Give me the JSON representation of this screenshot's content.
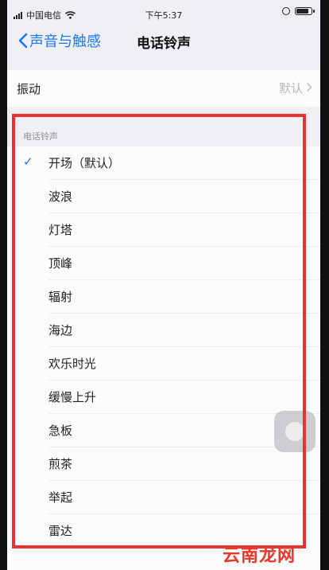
{
  "status_bar": {
    "carrier": "中国电信",
    "time": "下午5:37"
  },
  "nav": {
    "back_label": "声音与触感",
    "title": "电话铃声"
  },
  "vibration": {
    "label": "振动",
    "value": "默认"
  },
  "ringtones": {
    "section_header": "电话铃声",
    "items": [
      {
        "name": "开场（默认）",
        "selected": true
      },
      {
        "name": "波浪"
      },
      {
        "name": "灯塔"
      },
      {
        "name": "顶峰"
      },
      {
        "name": "辐射"
      },
      {
        "name": "海边"
      },
      {
        "name": "欢乐时光"
      },
      {
        "name": "缓慢上升"
      },
      {
        "name": "急板"
      },
      {
        "name": "煎茶"
      },
      {
        "name": "举起"
      },
      {
        "name": "雷达"
      }
    ]
  },
  "colors": {
    "accent": "#1d7af2",
    "highlight_border": "#e83232"
  },
  "watermark": "云南龙网"
}
